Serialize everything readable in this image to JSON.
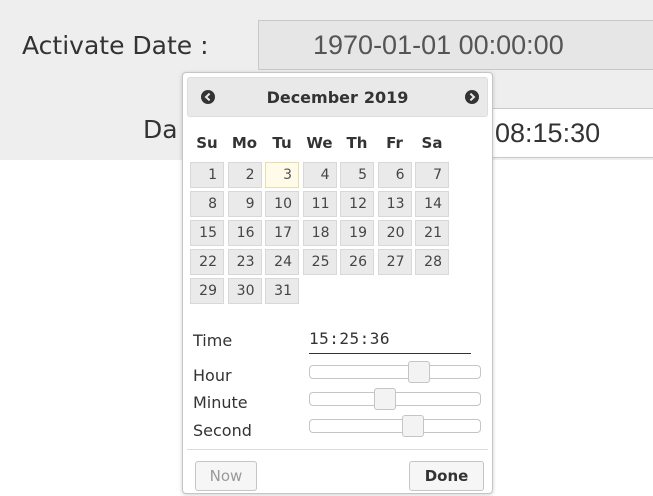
{
  "form": {
    "activate_label": "Activate Date :",
    "activate_value": "1970-01-01 00:00:00",
    "second_label_partial": "Da",
    "second_value_partial": "08:15:30"
  },
  "datepicker": {
    "month": "December",
    "year": "2019",
    "prev_icon": "circle-left-arrow-icon",
    "next_icon": "circle-right-arrow-icon",
    "days_of_week": [
      "Su",
      "Mo",
      "Tu",
      "We",
      "Th",
      "Fr",
      "Sa"
    ],
    "weeks": [
      [
        "1",
        "2",
        "3",
        "4",
        "5",
        "6",
        "7"
      ],
      [
        "8",
        "9",
        "10",
        "11",
        "12",
        "13",
        "14"
      ],
      [
        "15",
        "16",
        "17",
        "18",
        "19",
        "20",
        "21"
      ],
      [
        "22",
        "23",
        "24",
        "25",
        "26",
        "27",
        "28"
      ],
      [
        "29",
        "30",
        "31"
      ]
    ],
    "today_day": "3",
    "time_label": "Time",
    "time_value": "15:25:36",
    "hour_label": "Hour",
    "minute_label": "Minute",
    "second_label": "Second",
    "hour": 15,
    "minute": 25,
    "second": 36,
    "now_label": "Now",
    "done_label": "Done"
  }
}
